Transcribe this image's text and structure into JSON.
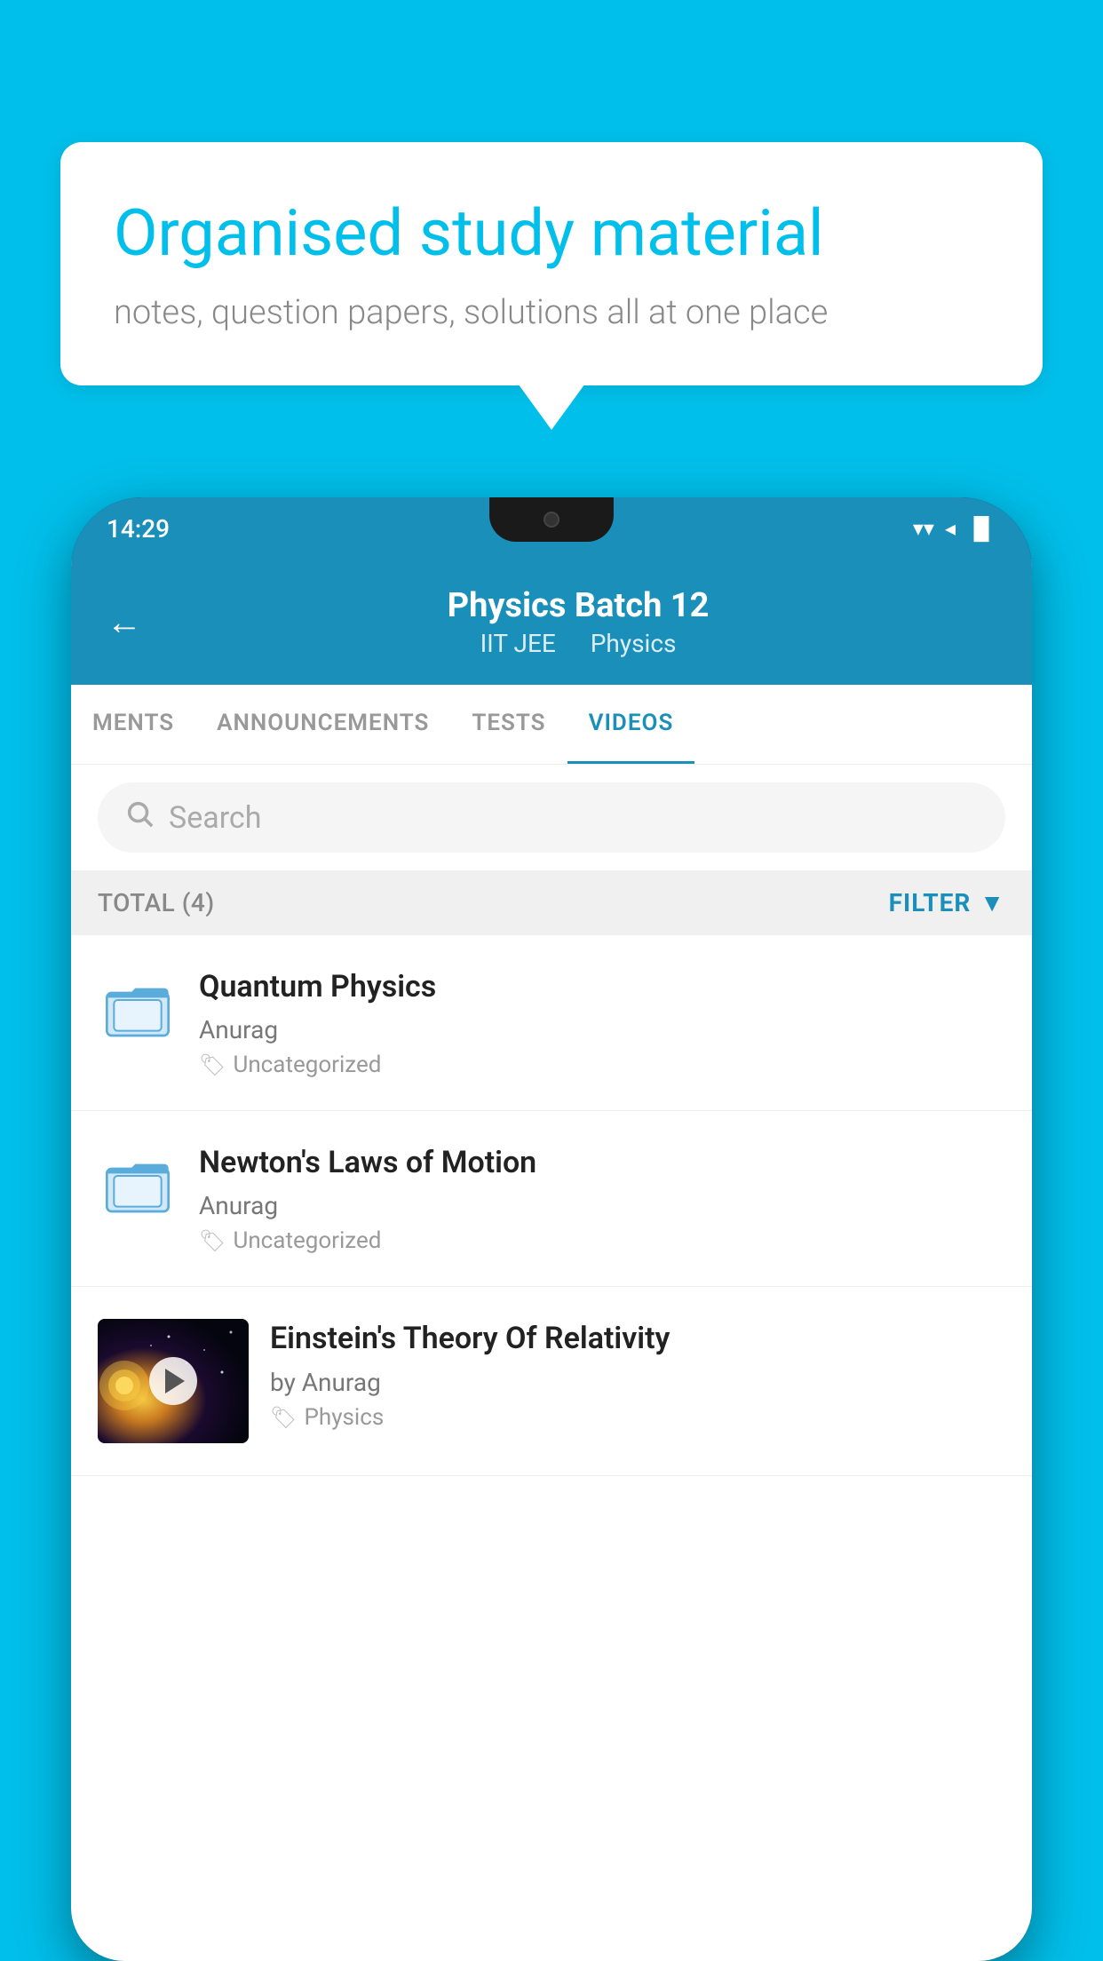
{
  "background_color": "#00BFEA",
  "speech_bubble": {
    "title": "Organised study material",
    "subtitle": "notes, question papers, solutions all at one place"
  },
  "status_bar": {
    "time": "14:29",
    "wifi_icon": "▼",
    "signal_icon": "◂",
    "battery_icon": "▐"
  },
  "app_header": {
    "back_label": "←",
    "title": "Physics Batch 12",
    "subtitle_part1": "IIT JEE",
    "subtitle_part2": "Physics"
  },
  "tabs": [
    {
      "label": "MENTS",
      "active": false
    },
    {
      "label": "ANNOUNCEMENTS",
      "active": false
    },
    {
      "label": "TESTS",
      "active": false
    },
    {
      "label": "VIDEOS",
      "active": true
    }
  ],
  "search": {
    "placeholder": "Search"
  },
  "filter_bar": {
    "total_label": "TOTAL (4)",
    "filter_label": "FILTER"
  },
  "videos": [
    {
      "title": "Quantum Physics",
      "author": "Anurag",
      "tag": "Uncategorized",
      "has_thumbnail": false
    },
    {
      "title": "Newton's Laws of Motion",
      "author": "Anurag",
      "tag": "Uncategorized",
      "has_thumbnail": false
    },
    {
      "title": "Einstein's Theory Of Relativity",
      "author": "by Anurag",
      "tag": "Physics",
      "has_thumbnail": true
    }
  ]
}
